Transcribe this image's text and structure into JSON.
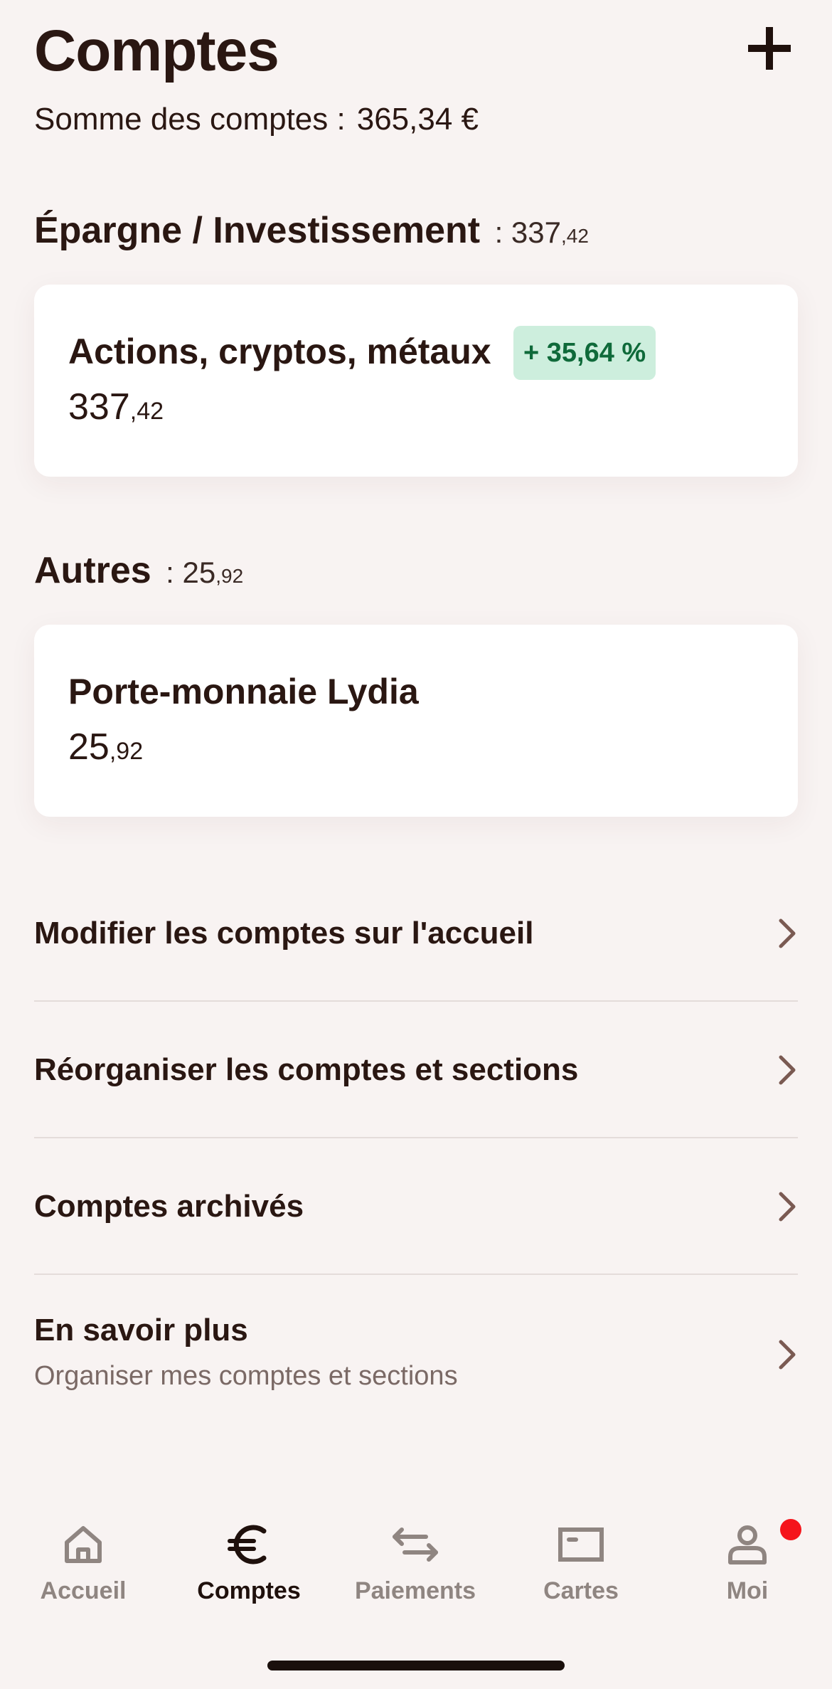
{
  "header": {
    "title": "Comptes",
    "sum_label": "Somme des comptes :",
    "sum_value": "365,34 €"
  },
  "sections": [
    {
      "title": "Épargne / Investissement",
      "total_main": ": 337",
      "total_cents": ",42",
      "cards": [
        {
          "title": "Actions, cryptos, métaux",
          "badge": "+ 35,64 %",
          "amount_main": "337",
          "amount_cents": ",42"
        }
      ]
    },
    {
      "title": "Autres",
      "total_main": ": 25",
      "total_cents": ",92",
      "cards": [
        {
          "title": "Porte-monnaie Lydia",
          "amount_main": "25",
          "amount_cents": ",92"
        }
      ]
    }
  ],
  "menu": [
    {
      "label": "Modifier les comptes sur l'accueil"
    },
    {
      "label": "Réorganiser les comptes et sections"
    },
    {
      "label": "Comptes archivés"
    },
    {
      "label": "En savoir plus",
      "sublabel": "Organiser mes comptes et sections"
    }
  ],
  "nav": {
    "items": [
      {
        "label": "Accueil",
        "icon": "home-icon"
      },
      {
        "label": "Comptes",
        "icon": "euro-icon",
        "active": true
      },
      {
        "label": "Paiements",
        "icon": "transfer-arrows-icon"
      },
      {
        "label": "Cartes",
        "icon": "card-icon"
      },
      {
        "label": "Moi",
        "icon": "person-icon",
        "notification": true
      }
    ]
  },
  "colors": {
    "background": "#f8f3f2",
    "text": "#2a1712",
    "badge_bg": "#cdeedd",
    "badge_text": "#0f6a3a",
    "nav_inactive": "#8f8581",
    "notification": "#f5141b"
  }
}
